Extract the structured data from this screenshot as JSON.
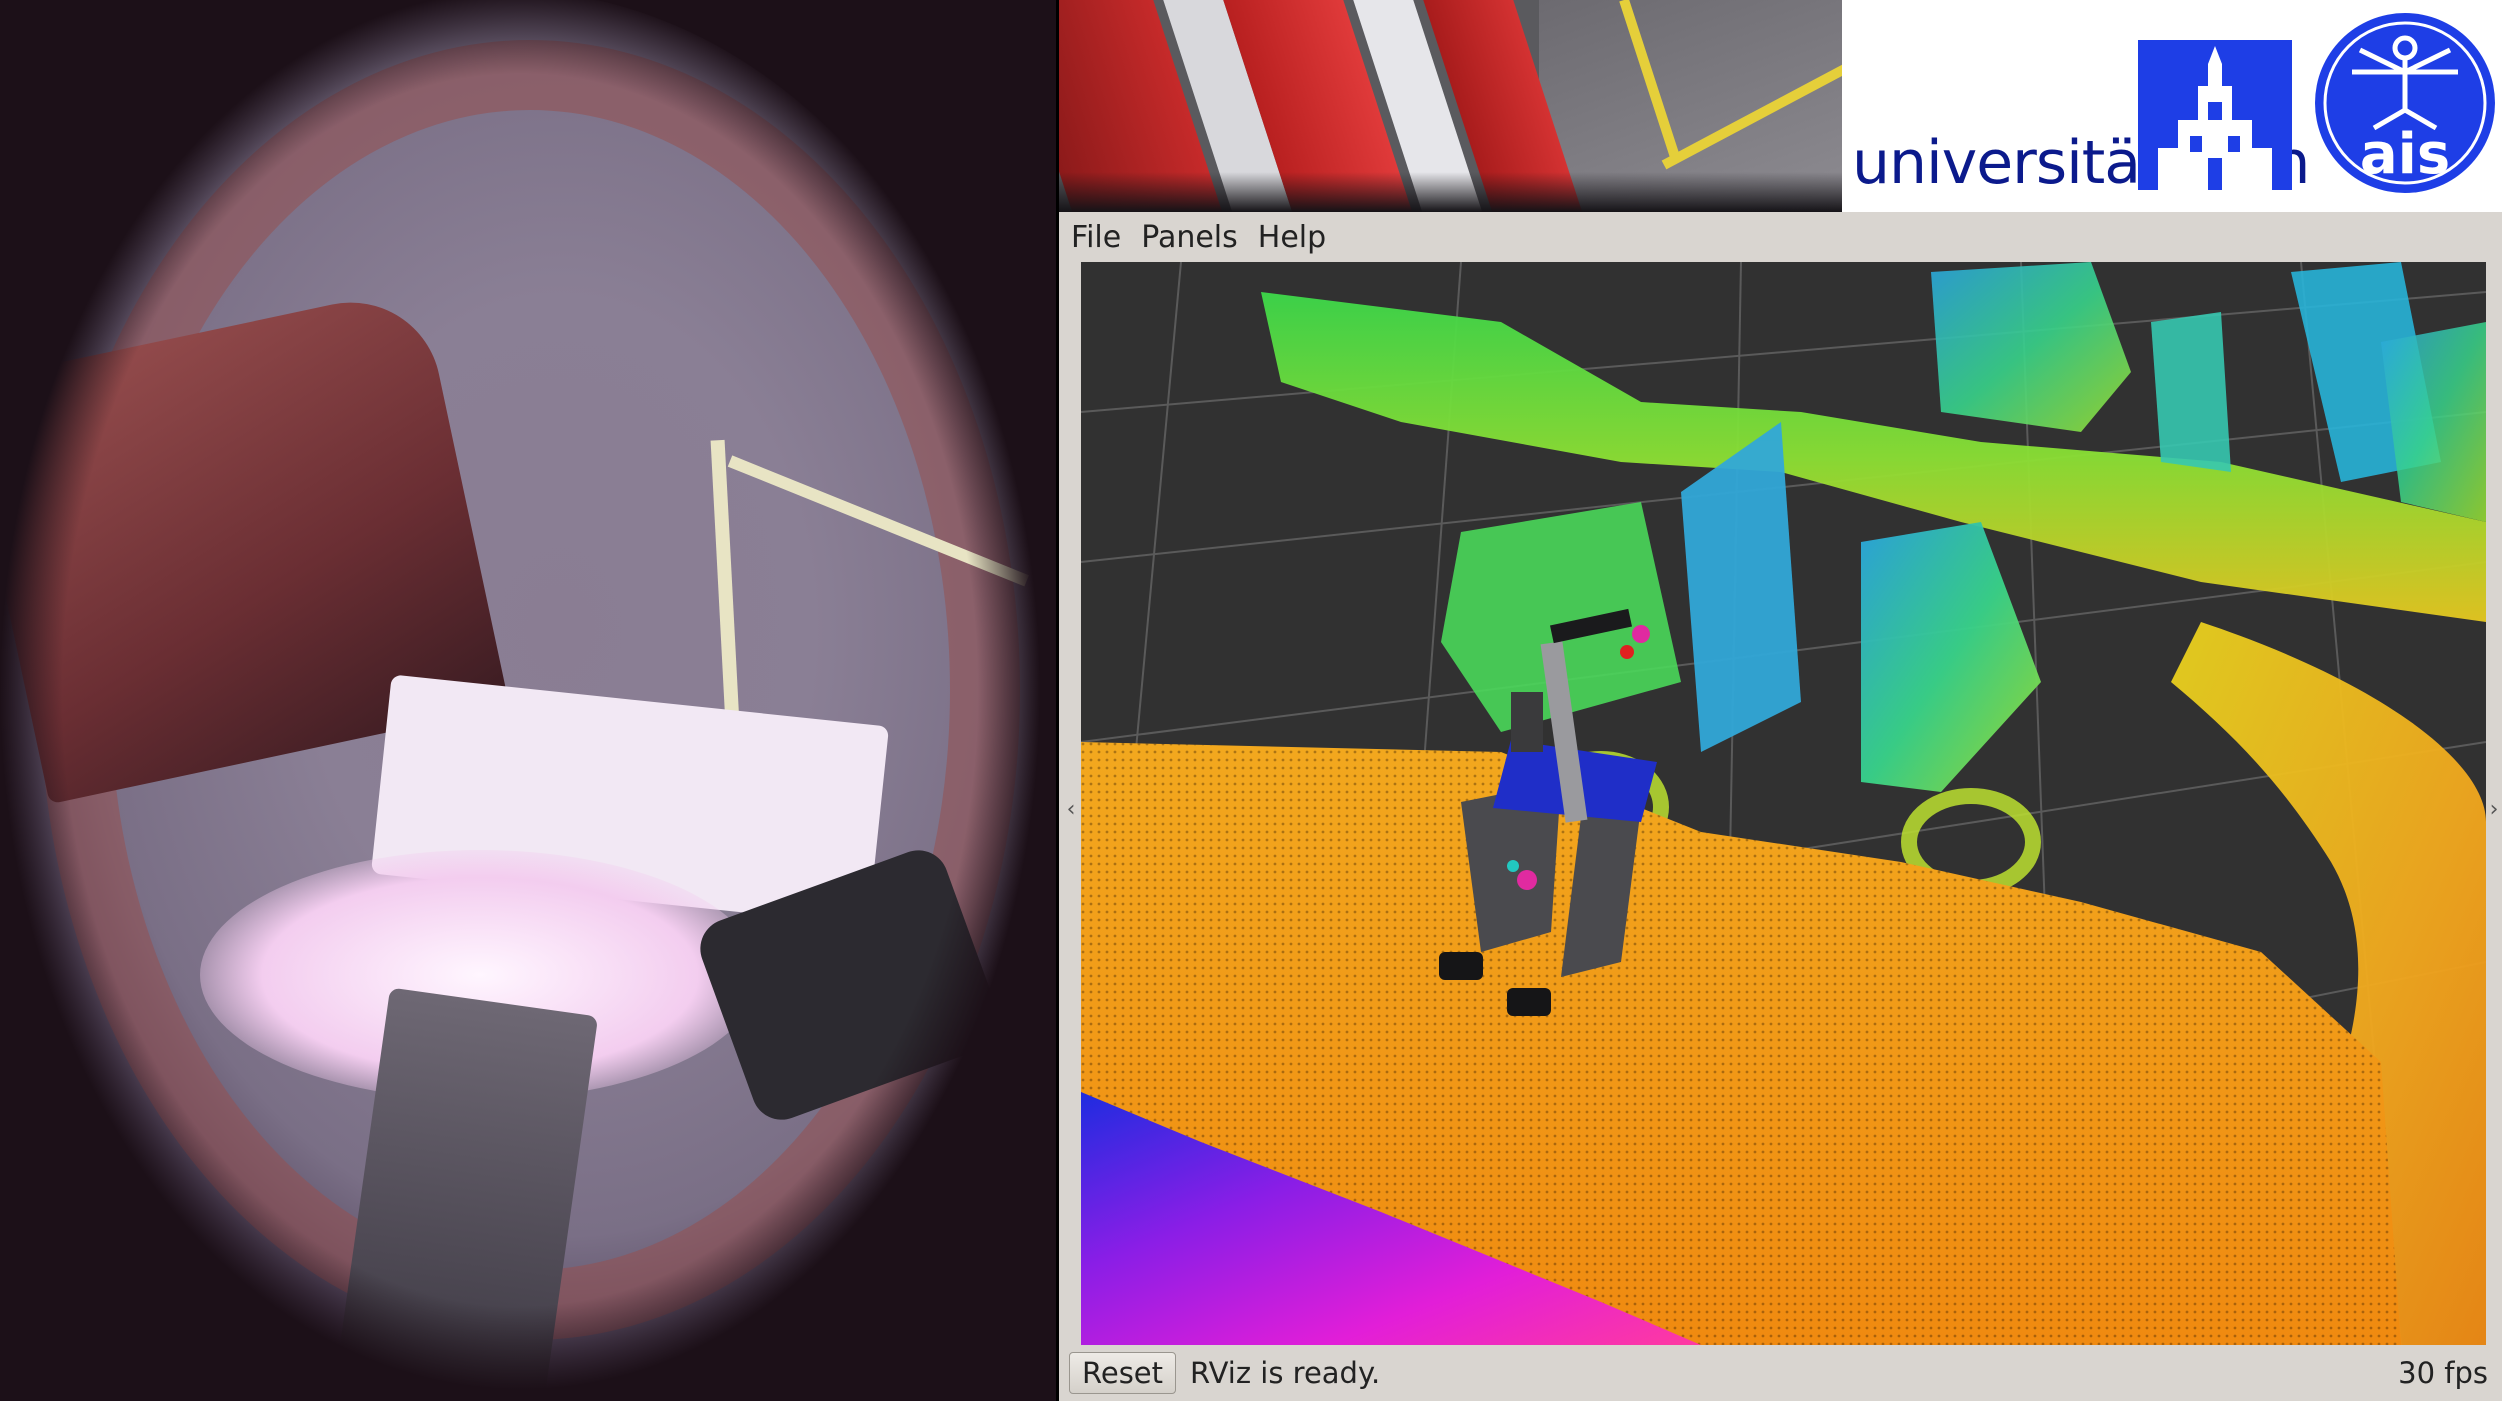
{
  "logos": {
    "university_name_light": "universität",
    "university_name_bold": "bonn",
    "lab_abbrev": "ais"
  },
  "rviz": {
    "menu": [
      "File",
      "Panels",
      "Help"
    ],
    "status": {
      "reset_label": "Reset",
      "message": "RViz is ready.",
      "fps": "30 fps"
    },
    "colors": {
      "background": "#313131",
      "grid": "#5a5a5a",
      "robot_base": "#1f2ec8"
    }
  }
}
